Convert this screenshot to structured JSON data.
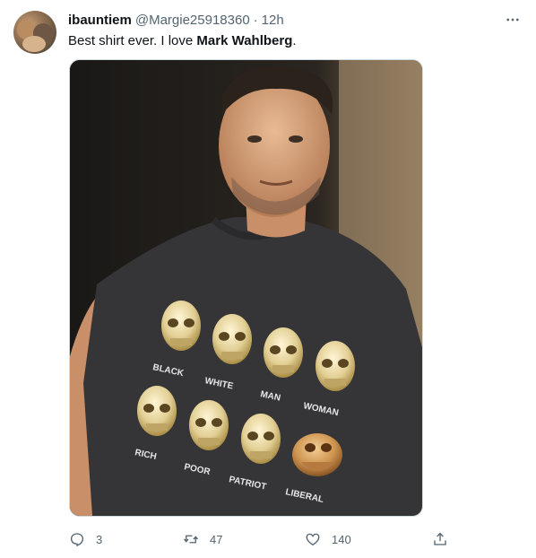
{
  "tweet": {
    "author_name": "ibauntiem",
    "handle": "@Margie25918360",
    "separator": "·",
    "time": "12h",
    "text_before": "Best shirt ever. I love ",
    "text_bold": "Mark Wahlberg",
    "text_after": ".",
    "more_icon": "more-horizontal-icon"
  },
  "media": {
    "shirt_words": [
      "BLACK",
      "WHITE",
      "MAN",
      "WOMAN",
      "RICH",
      "POOR",
      "PATRIOT",
      "LIBERAL"
    ]
  },
  "actions": {
    "replies": "3",
    "retweets": "47",
    "likes": "140",
    "reply_icon": "reply-icon",
    "retweet_icon": "retweet-icon",
    "like_icon": "heart-icon",
    "share_icon": "share-icon"
  },
  "colors": {
    "secondary_text": "#536471",
    "primary_text": "#0f1419"
  }
}
